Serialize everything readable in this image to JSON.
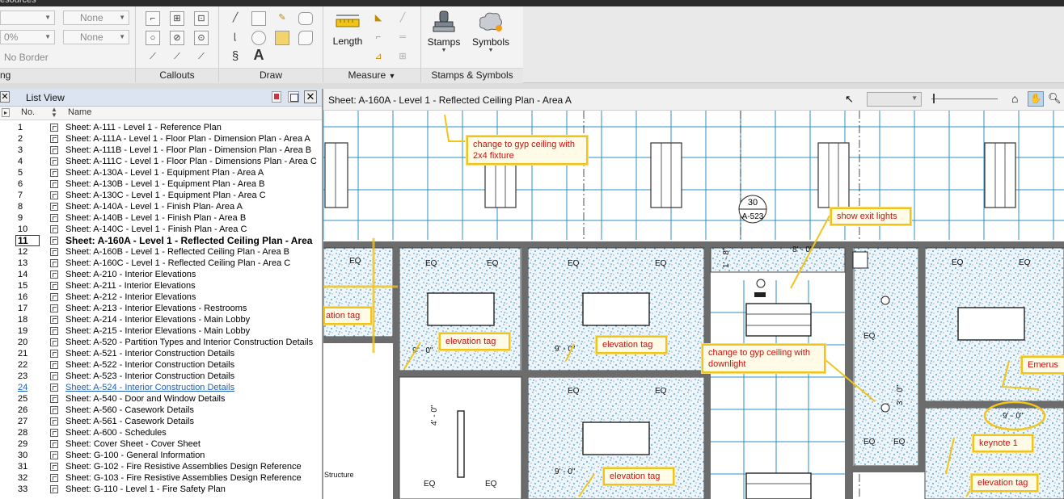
{
  "topbar": {
    "partial_tab": "esources"
  },
  "ribbon": {
    "style_dropdown1": "",
    "style_dropdown2": "None",
    "opacity_dropdown": "0%",
    "line_end_dropdown": "None",
    "border_label": "No Border",
    "callouts_label": "Callouts",
    "draw_label": "Draw",
    "measure": {
      "length_label": "Length",
      "group_label": "Measure"
    },
    "stamps_label": "Stamps",
    "symbols_label": "Symbols",
    "stamps_group_label": "Stamps & Symbols",
    "partial_group_label": "ng"
  },
  "list_view": {
    "title": "List View",
    "col_no": "No.",
    "col_name": "Name",
    "rows": [
      {
        "no": "1",
        "name": "Sheet: A-111 - Level 1 - Reference Plan"
      },
      {
        "no": "2",
        "name": "Sheet: A-111A - Level 1 - Floor Plan - Dimension Plan - Area A"
      },
      {
        "no": "3",
        "name": "Sheet: A-111B - Level 1 - Floor Plan - Dimension Plan - Area B"
      },
      {
        "no": "4",
        "name": "Sheet: A-111C - Level 1 - Floor Plan - Dimensions Plan - Area C"
      },
      {
        "no": "5",
        "name": "Sheet: A-130A - Level 1 - Equipment Plan - Area A"
      },
      {
        "no": "6",
        "name": "Sheet: A-130B - Level 1 - Equipment Plan - Area B"
      },
      {
        "no": "7",
        "name": "Sheet: A-130C - Level 1 - Equipment Plan - Area C"
      },
      {
        "no": "8",
        "name": "Sheet: A-140A - Level 1 - Finish Plan- Area A"
      },
      {
        "no": "9",
        "name": "Sheet: A-140B - Level 1 - Finish Plan - Area B"
      },
      {
        "no": "10",
        "name": "Sheet: A-140C - Level 1 - Finish Plan - Area C"
      },
      {
        "no": "11",
        "name": "Sheet: A-160A - Level 1 - Reflected Ceiling Plan - Area"
      },
      {
        "no": "12",
        "name": "Sheet: A-160B - Level 1 - Reflected Ceiling Plan - Area B"
      },
      {
        "no": "13",
        "name": "Sheet: A-160C - Level 1 - Reflected Ceiling Plan - Area C"
      },
      {
        "no": "14",
        "name": "Sheet: A-210 - Interior Elevations"
      },
      {
        "no": "15",
        "name": "Sheet: A-211 - Interior Elevations"
      },
      {
        "no": "16",
        "name": "Sheet: A-212 - Interior Elevations"
      },
      {
        "no": "17",
        "name": "Sheet: A-213 - Interior Elevations - Restrooms"
      },
      {
        "no": "18",
        "name": "Sheet: A-214 - Interior Elevations - Main Lobby"
      },
      {
        "no": "19",
        "name": "Sheet: A-215 - Interior Elevations - Main Lobby"
      },
      {
        "no": "20",
        "name": "Sheet: A-520 - Partition Types and Interior Construction Details"
      },
      {
        "no": "21",
        "name": "Sheet: A-521 - Interior Construction Details"
      },
      {
        "no": "22",
        "name": "Sheet: A-522 - Interior Construction Details"
      },
      {
        "no": "23",
        "name": "Sheet: A-523 - Interior Construction Details"
      },
      {
        "no": "24",
        "name": "Sheet: A-524 - Interior Construction Details"
      },
      {
        "no": "25",
        "name": "Sheet: A-540 - Door and Window Details"
      },
      {
        "no": "26",
        "name": "Sheet: A-560 - Casework Details"
      },
      {
        "no": "27",
        "name": "Sheet: A-561 - Casework Details"
      },
      {
        "no": "28",
        "name": "Sheet: A-600 - Schedules"
      },
      {
        "no": "29",
        "name": "Sheet: Cover Sheet - Cover Sheet"
      },
      {
        "no": "30",
        "name": "Sheet: G-100 - General Information"
      },
      {
        "no": "31",
        "name": "Sheet: G-102 - Fire Resistive Assemblies Design Reference"
      },
      {
        "no": "32",
        "name": "Sheet: G-103 - Fire Resistive Assemblies Design Reference"
      },
      {
        "no": "33",
        "name": "Sheet: G-110 - Level 1 - Fire Safety Plan"
      }
    ],
    "selected_index": 10,
    "visited_index": 23
  },
  "view": {
    "title": "Sheet: A-160A - Level 1 - Reflected Ceiling Plan - Area A",
    "annotations": {
      "gyp_fixture": "change to gyp ceiling with 2x4 fixture",
      "exit_lights": "show exit lights",
      "gyp_downlight": "change to gyp ceiling with downlight",
      "elevation_tag": "elevation tag",
      "ation_tag": "ation tag",
      "keynote": "keynote 1",
      "emerus": "Emerus"
    },
    "labels": {
      "eq": "EQ",
      "section_num": "30",
      "section_sheet": "A-523",
      "dim_9_0": "9' - 0\"",
      "dim_8_0": "8' - 0\"",
      "dim_4_0": "4' - 0\"",
      "dim_3_0": "3' - 0\"",
      "dim_1_8": "1' - 8\"",
      "structure": "Structure"
    }
  },
  "colors": {
    "accent": "#f0c419",
    "annotation_text": "#cc1010",
    "grid": "#2b8fc4",
    "wall": "#555555"
  }
}
